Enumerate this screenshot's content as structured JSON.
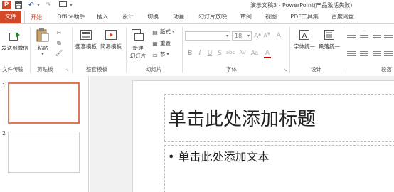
{
  "window": {
    "title": "演示文稿3 - PowerPoint(产品激活失败)"
  },
  "quick_access": {
    "logo_letter": "P",
    "icons": [
      "save-icon",
      "undo-icon",
      "redo-icon",
      "start-from-beginning-icon"
    ]
  },
  "tabs": [
    {
      "label": "文件"
    },
    {
      "label": "开始"
    },
    {
      "label": "Office助手"
    },
    {
      "label": "插入"
    },
    {
      "label": "设计"
    },
    {
      "label": "切换"
    },
    {
      "label": "动画"
    },
    {
      "label": "幻灯片放映"
    },
    {
      "label": "审阅"
    },
    {
      "label": "视图"
    },
    {
      "label": "PDF工具集"
    },
    {
      "label": "百度网盘"
    }
  ],
  "ribbon": {
    "file_transfer": {
      "button": "发送到微信",
      "group": "文件传输"
    },
    "clipboard": {
      "paste": "粘贴",
      "group": "剪贴板"
    },
    "tidy": {
      "organize": "整套模板",
      "simple": "简易模板",
      "group": "整套模板"
    },
    "slides": {
      "new_slide_line1": "新建",
      "new_slide_line2": "幻灯片",
      "layout": "版式",
      "reset": "重置",
      "section": "节",
      "group": "幻灯片"
    },
    "font": {
      "size": "18",
      "group": "字体",
      "bold": "B",
      "italic": "I",
      "underline": "U",
      "strike": "S",
      "shadow": "abc",
      "spacing": "AV",
      "case": "Aa",
      "color": "A"
    },
    "design": {
      "font_unify": "字体统一",
      "para_unify": "段落统一",
      "group": "设计"
    },
    "paragraph": {
      "group": "段落"
    }
  },
  "slide_pane": {
    "thumbnails": [
      {
        "number": "1",
        "selected": true
      },
      {
        "number": "2",
        "selected": false
      }
    ]
  },
  "slide": {
    "title_placeholder": "单击此处添加标题",
    "body_placeholder": "• 单击此处添加文本"
  },
  "colors": {
    "accent": "#d24726",
    "thumb_selected": "#e07857"
  }
}
